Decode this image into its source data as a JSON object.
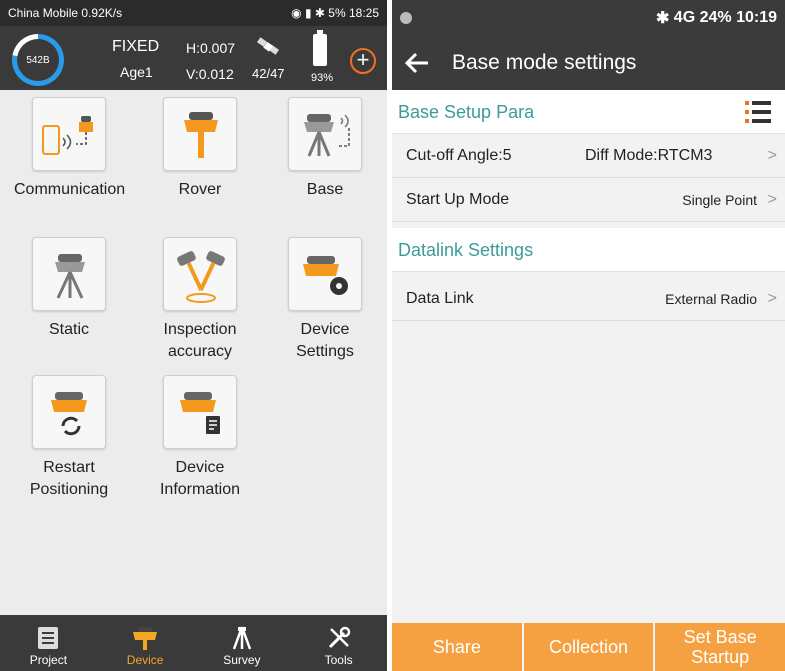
{
  "left": {
    "status": {
      "carrier": "China Mobile",
      "signal": "all",
      "speed": "0.92K/s",
      "icons": "◉ ▮ ✱",
      "battery": "5%",
      "time": "18:25"
    },
    "header": {
      "ring_value": "542B",
      "fix_status": "FIXED",
      "age": "Age1",
      "h_precision": "H:0.007",
      "v_precision": "V:0.012",
      "satellites": "42/47",
      "battery_percent": "93%",
      "plus_symbol": "+"
    },
    "grid": [
      {
        "label": "Communication",
        "icon": "phone-device-icon"
      },
      {
        "label": "Rover",
        "icon": "rover-receiver-icon"
      },
      {
        "label": "Base",
        "icon": "base-receiver-icon"
      },
      {
        "label": "Static",
        "icon": "tripod-icon"
      },
      {
        "label": "Inspection accuracy",
        "icon": "inspection-icon"
      },
      {
        "label": "Device Settings",
        "icon": "gear-receiver-icon"
      },
      {
        "label": "Restart Positioning",
        "icon": "restart-icon"
      },
      {
        "label": "Device Information",
        "icon": "info-doc-icon"
      }
    ],
    "nav": [
      {
        "label": "Project",
        "icon": "list-icon",
        "active": false
      },
      {
        "label": "Device",
        "icon": "receiver-icon",
        "active": true
      },
      {
        "label": "Survey",
        "icon": "survey-icon",
        "active": false
      },
      {
        "label": "Tools",
        "icon": "tools-icon",
        "active": false
      }
    ],
    "accent": "#f5a623"
  },
  "right": {
    "status": {
      "bluetooth": "✱",
      "network": "4G",
      "battery": "24%",
      "time": "10:19"
    },
    "title": "Base mode settings",
    "section1": "Base Setup Para",
    "rows1": [
      {
        "label": "Cut-off Angle:5",
        "middle": "Diff Mode:RTCM3",
        "value": ""
      },
      {
        "label": "Start Up Mode",
        "middle": "",
        "value": "Single Point"
      }
    ],
    "section2": "Datalink Settings",
    "rows2": [
      {
        "label": "Data Link",
        "middle": "",
        "value": "External Radio"
      }
    ],
    "chevron": ">",
    "footer": [
      "Share",
      "Collection",
      "Set Base Startup"
    ],
    "accent": "#f5a142",
    "section_color": "#3d9a9a"
  }
}
